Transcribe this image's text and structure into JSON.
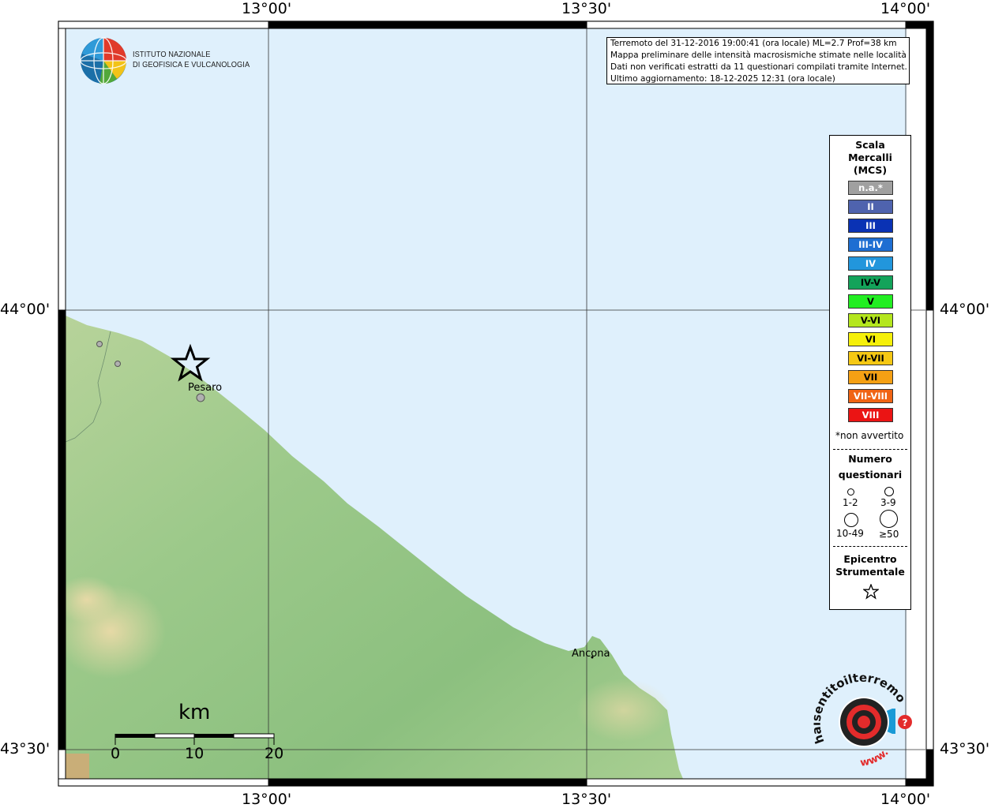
{
  "map": {
    "lon_labels": [
      "13°00'",
      "13°30'",
      "14°00'"
    ],
    "lat_labels": [
      "44°00'",
      "43°30'"
    ],
    "colors": {
      "sea": "#dff0fc",
      "land": "#9cc98a",
      "star": "#000000"
    }
  },
  "logo": {
    "line1": "ISTITUTO NAZIONALE",
    "line2": "DI GEOFISICA E VULCANOLOGIA"
  },
  "info_box": {
    "line1": "Terremoto del 31-12-2016 19:00:41 (ora locale) ML=2.7 Prof=38 km",
    "line2": "Mappa preliminare delle intensità macrosismiche stimate nelle località",
    "line3": "Dati non verificati estratti da 11 questionari compilati tramite Internet.",
    "line4": "Ultimo aggiornamento: 18-12-2025 12:31 (ora locale)"
  },
  "places": {
    "pesaro": "Pesaro",
    "ancona": "Ancona"
  },
  "scale_bar": {
    "unit": "km",
    "ticks": [
      "0",
      "10",
      "20"
    ]
  },
  "legend": {
    "title1": "Scala",
    "title2": "Mercalli",
    "title3": "(MCS)",
    "intensities": [
      {
        "label": "n.a.*",
        "color": "#a0a0a0"
      },
      {
        "label": "II",
        "color": "#4f63ae"
      },
      {
        "label": "III",
        "color": "#0a32b4"
      },
      {
        "label": "III-IV",
        "color": "#1e6ed2"
      },
      {
        "label": "IV",
        "color": "#2296dc"
      },
      {
        "label": "IV-V",
        "color": "#13a35a"
      },
      {
        "label": "V",
        "color": "#22ee22"
      },
      {
        "label": "V-VI",
        "color": "#b4e61e"
      },
      {
        "label": "VI",
        "color": "#f5f00a"
      },
      {
        "label": "VI-VII",
        "color": "#f5c814"
      },
      {
        "label": "VII",
        "color": "#f5a014"
      },
      {
        "label": "VII-VIII",
        "color": "#f06414"
      },
      {
        "label": "VIII",
        "color": "#eb1414"
      }
    ],
    "note": "*non avvertito",
    "numero": "Numero",
    "questionari": "questionari",
    "sizes": [
      "1-2",
      "3-9",
      "10-49",
      "≥50"
    ],
    "epicentro": "Epicentro",
    "strumentale": "Strumentale"
  },
  "brand": {
    "ring_text": "haisentitoilterremoto.it",
    "www": "www."
  }
}
